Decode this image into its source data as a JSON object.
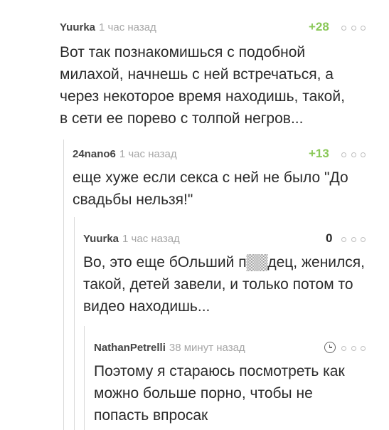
{
  "comments": [
    {
      "author": "Yuurka",
      "time": "1 час назад",
      "rating": "+28",
      "text": "Вот так познакомишься с подобной\nмилахой, начнешь с ней встречаться, а\nчерез некоторое время находишь, такой,\nв сети ее порево с толпой негров..."
    },
    {
      "author": "24nano6",
      "time": "1 час назад",
      "rating": "+13",
      "text": "еще хуже если секса  с ней не было \"До\nсвадьбы нельзя!\""
    },
    {
      "author": "Yuurka",
      "time": "1 час назад",
      "rating": "0",
      "text": "Во, это еще бОльший п▒▒дец, женился,\nтакой, детей завели, и только потом то\nвидео находишь..."
    },
    {
      "author": "NathanPetrelli",
      "time": "38 минут назад",
      "rating": "",
      "text": "Поэтому я стараюсь посмотреть как\nможно больше порно, чтобы не\nпопасть впросак"
    }
  ],
  "icons": {
    "more": "more-dots-icon",
    "clock": "clock-icon"
  },
  "colors": {
    "positive_rating": "#8ac858",
    "meta_gray": "#a6a6a6",
    "thread_line": "#d9d9d9"
  }
}
